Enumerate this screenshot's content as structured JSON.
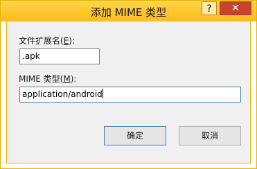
{
  "window": {
    "title": "添加 MIME 类型",
    "help_glyph": "?",
    "close_glyph": "✕"
  },
  "form": {
    "extension_label_pre": "文件扩展名(",
    "extension_label_key": "E",
    "extension_label_post": "):",
    "extension_value": ".apk",
    "mime_label_pre": "MIME 类型(",
    "mime_label_key": "M",
    "mime_label_post": "):",
    "mime_value": "application/android"
  },
  "buttons": {
    "ok_label": "确定",
    "cancel_label": "取消"
  }
}
